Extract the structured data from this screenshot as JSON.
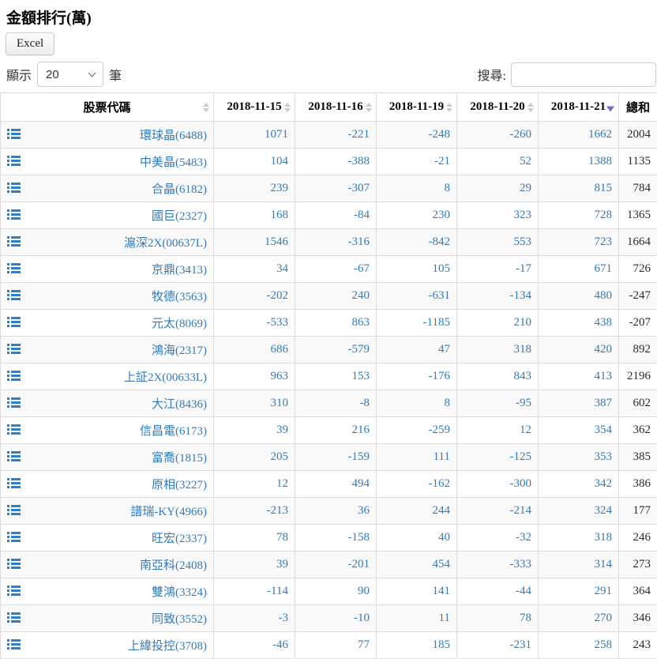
{
  "page": {
    "title": "金額排行(萬)"
  },
  "toolbar": {
    "excel_label": "Excel"
  },
  "length_control": {
    "prefix": "顯示",
    "selected": "20",
    "suffix": "筆"
  },
  "search": {
    "label": "搜尋:",
    "value": ""
  },
  "icons": {
    "row_icon": "list-icon",
    "select_icon": "chevron-down-icon",
    "sort_inactive": "sort-both-icon",
    "sort_active": "sort-desc-icon"
  },
  "colors": {
    "link_blue": "#337ab7",
    "icon_blue": "#2e80c6",
    "sort_active": "#6f6fc0",
    "stripe": "#f9f9f9",
    "border": "#dddddd"
  },
  "table": {
    "columns": [
      {
        "key": "stock-code",
        "label": "股票代碼",
        "sort": "both"
      },
      {
        "key": "2018-11-15",
        "label": "2018-11-15",
        "sort": "both"
      },
      {
        "key": "2018-11-16",
        "label": "2018-11-16",
        "sort": "both"
      },
      {
        "key": "2018-11-19",
        "label": "2018-11-19",
        "sort": "both"
      },
      {
        "key": "2018-11-20",
        "label": "2018-11-20",
        "sort": "both"
      },
      {
        "key": "2018-11-21",
        "label": "2018-11-21",
        "sort": "desc"
      },
      {
        "key": "total",
        "label": "總和",
        "sort": "none"
      }
    ],
    "rows": [
      {
        "name": "環球晶(6488)",
        "values": [
          1071,
          -221,
          -248,
          -260,
          1662
        ],
        "total": 2004
      },
      {
        "name": "中美晶(5483)",
        "values": [
          104,
          -388,
          -21,
          52,
          1388
        ],
        "total": 1135
      },
      {
        "name": "合晶(6182)",
        "values": [
          239,
          -307,
          8,
          29,
          815
        ],
        "total": 784
      },
      {
        "name": "國巨(2327)",
        "values": [
          168,
          -84,
          230,
          323,
          728
        ],
        "total": 1365
      },
      {
        "name": "滬深2X(00637L)",
        "values": [
          1546,
          -316,
          -842,
          553,
          723
        ],
        "total": 1664
      },
      {
        "name": "京鼎(3413)",
        "values": [
          34,
          -67,
          105,
          -17,
          671
        ],
        "total": 726
      },
      {
        "name": "牧德(3563)",
        "values": [
          -202,
          240,
          -631,
          -134,
          480
        ],
        "total": -247
      },
      {
        "name": "元太(8069)",
        "values": [
          -533,
          863,
          -1185,
          210,
          438
        ],
        "total": -207
      },
      {
        "name": "鴻海(2317)",
        "values": [
          686,
          -579,
          47,
          318,
          420
        ],
        "total": 892
      },
      {
        "name": "上証2X(00633L)",
        "values": [
          963,
          153,
          -176,
          843,
          413
        ],
        "total": 2196
      },
      {
        "name": "大江(8436)",
        "values": [
          310,
          -8,
          8,
          -95,
          387
        ],
        "total": 602
      },
      {
        "name": "信昌電(6173)",
        "values": [
          39,
          216,
          -259,
          12,
          354
        ],
        "total": 362
      },
      {
        "name": "富喬(1815)",
        "values": [
          205,
          -159,
          111,
          -125,
          353
        ],
        "total": 385
      },
      {
        "name": "原相(3227)",
        "values": [
          12,
          494,
          -162,
          -300,
          342
        ],
        "total": 386
      },
      {
        "name": "譜瑞-KY(4966)",
        "values": [
          -213,
          36,
          244,
          -214,
          324
        ],
        "total": 177
      },
      {
        "name": "旺宏(2337)",
        "values": [
          78,
          -158,
          40,
          -32,
          318
        ],
        "total": 246
      },
      {
        "name": "南亞科(2408)",
        "values": [
          39,
          -201,
          454,
          -333,
          314
        ],
        "total": 273
      },
      {
        "name": "雙鴻(3324)",
        "values": [
          -114,
          90,
          141,
          -44,
          291
        ],
        "total": 364
      },
      {
        "name": "同致(3552)",
        "values": [
          -3,
          -10,
          11,
          78,
          270
        ],
        "total": 346
      },
      {
        "name": "上緯投控(3708)",
        "values": [
          -46,
          77,
          185,
          -231,
          258
        ],
        "total": 243
      }
    ]
  }
}
